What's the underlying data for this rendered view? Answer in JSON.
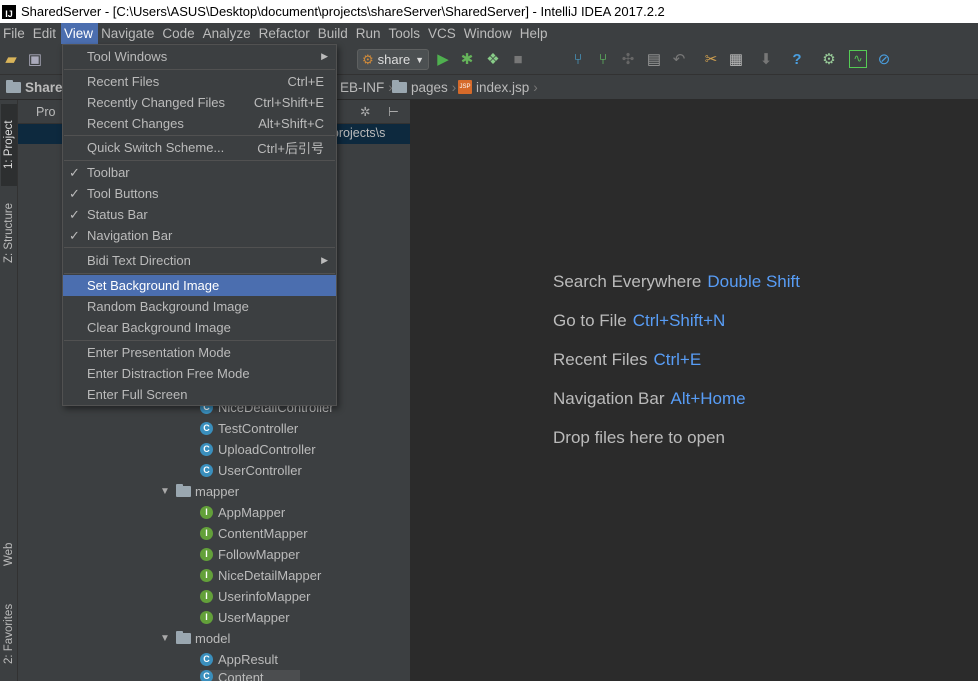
{
  "title_bar": {
    "logo": "IJ",
    "text": "SharedServer - [C:\\Users\\ASUS\\Desktop\\document\\projects\\shareServer\\SharedServer] - IntelliJ IDEA 2017.2.2"
  },
  "menu": {
    "file": "File",
    "edit": "Edit",
    "view": "View",
    "navigate": "Navigate",
    "code": "Code",
    "analyze": "Analyze",
    "refactor": "Refactor",
    "build": "Build",
    "run": "Run",
    "tools": "Tools",
    "vcs": "VCS",
    "window": "Window",
    "help": "Help"
  },
  "toolbar": {
    "run_config": "share"
  },
  "nav": {
    "project": "Shared",
    "webinf": "EB-INF",
    "pages": "pages",
    "file": "index.jsp"
  },
  "left_tabs": {
    "project": "1: Project",
    "structure": "Z: Structure",
    "web": "Web",
    "favorites": "2: Favorites"
  },
  "panel": {
    "header": "Pro",
    "path": "nt\\projects\\s"
  },
  "view_menu": {
    "tool_windows": "Tool Windows",
    "recent_files": "Recent Files",
    "recent_files_sc": "Ctrl+E",
    "recently_changed": "Recently Changed Files",
    "recently_changed_sc": "Ctrl+Shift+E",
    "recent_changes": "Recent Changes",
    "recent_changes_sc": "Alt+Shift+C",
    "quick_switch": "Quick Switch Scheme...",
    "quick_switch_sc": "Ctrl+后引号",
    "toolbar": "Toolbar",
    "tool_buttons": "Tool Buttons",
    "status_bar": "Status Bar",
    "navigation_bar": "Navigation Bar",
    "bidi": "Bidi Text Direction",
    "set_bg": "Set Background Image",
    "random_bg": "Random Background Image",
    "clear_bg": "Clear Background Image",
    "presentation": "Enter Presentation Mode",
    "distraction_free": "Enter Distraction Free Mode",
    "full_screen": "Enter Full Screen"
  },
  "tree": {
    "controllers": [
      "NiceDetailController",
      "TestController",
      "UploadController",
      "UserController"
    ],
    "mapper_folder": "mapper",
    "mappers": [
      "AppMapper",
      "ContentMapper",
      "FollowMapper",
      "NiceDetailMapper",
      "UserinfoMapper",
      "UserMapper"
    ],
    "model_folder": "model",
    "models": [
      "AppResult",
      "Content"
    ]
  },
  "editor_hints": [
    {
      "text": "Search Everywhere",
      "key": "Double Shift"
    },
    {
      "text": "Go to File",
      "key": "Ctrl+Shift+N"
    },
    {
      "text": "Recent Files",
      "key": "Ctrl+E"
    },
    {
      "text": "Navigation Bar",
      "key": "Alt+Home"
    },
    {
      "text": "Drop files here to open",
      "key": ""
    }
  ]
}
